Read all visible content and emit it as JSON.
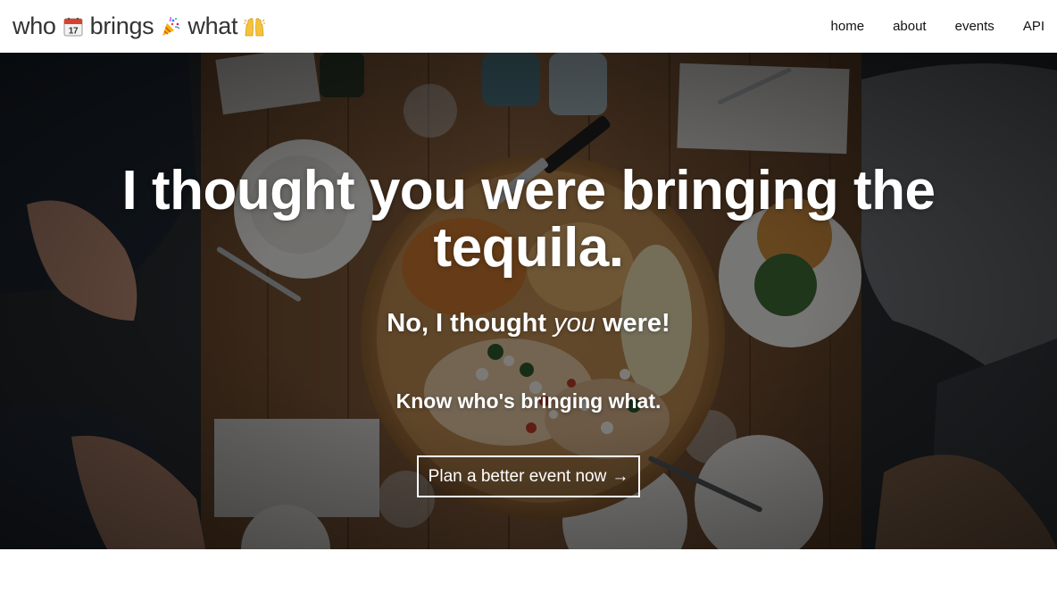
{
  "brand": {
    "words": [
      "who",
      "brings",
      "what"
    ],
    "emoji_icons": [
      "calendar-icon",
      "party-popper-icon",
      "raised-hands-icon"
    ],
    "calendar_day": "17"
  },
  "nav": {
    "home": "home",
    "about": "about",
    "events": "events",
    "api": "API"
  },
  "hero": {
    "headline_line1": "I thought you were bringing the",
    "headline_line2": "tequila.",
    "subline_before": "No, I thought ",
    "subline_emphasis": "you",
    "subline_after": " were!",
    "tagline": "Know who's bringing what.",
    "cta_label": "Plan a better event now",
    "cta_arrow": "→",
    "text_color": "#ffffff"
  }
}
